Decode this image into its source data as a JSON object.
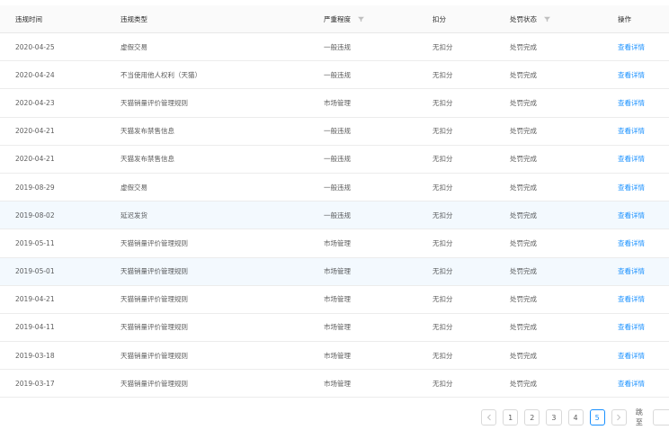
{
  "table": {
    "headers": {
      "date": "违规时间",
      "type": "违规类型",
      "severity": "严重程度",
      "deduction": "扣分",
      "status": "处罚状态",
      "action": "操作"
    },
    "rows": [
      {
        "date": "2020-04-25",
        "type": "虚假交易",
        "severity": "一般违规",
        "deduction": "无扣分",
        "status": "处罚完成",
        "action": "查看详情"
      },
      {
        "date": "2020-04-24",
        "type": "不当使用他人权利（天猫）",
        "severity": "一般违规",
        "deduction": "无扣分",
        "status": "处罚完成",
        "action": "查看详情"
      },
      {
        "date": "2020-04-23",
        "type": "天猫销量评价管理规则",
        "severity": "市场管理",
        "deduction": "无扣分",
        "status": "处罚完成",
        "action": "查看详情"
      },
      {
        "date": "2020-04-21",
        "type": "天猫发布禁售信息",
        "severity": "一般违规",
        "deduction": "无扣分",
        "status": "处罚完成",
        "action": "查看详情"
      },
      {
        "date": "2020-04-21",
        "type": "天猫发布禁售信息",
        "severity": "一般违规",
        "deduction": "无扣分",
        "status": "处罚完成",
        "action": "查看详情"
      },
      {
        "date": "2019-08-29",
        "type": "虚假交易",
        "severity": "一般违规",
        "deduction": "无扣分",
        "status": "处罚完成",
        "action": "查看详情"
      },
      {
        "date": "2019-08-02",
        "type": "延迟发货",
        "severity": "一般违规",
        "deduction": "无扣分",
        "status": "处罚完成",
        "action": "查看详情"
      },
      {
        "date": "2019-05-11",
        "type": "天猫销量评价管理规则",
        "severity": "市场管理",
        "deduction": "无扣分",
        "status": "处罚完成",
        "action": "查看详情"
      },
      {
        "date": "2019-05-01",
        "type": "天猫销量评价管理规则",
        "severity": "市场管理",
        "deduction": "无扣分",
        "status": "处罚完成",
        "action": "查看详情"
      },
      {
        "date": "2019-04-21",
        "type": "天猫销量评价管理规则",
        "severity": "市场管理",
        "deduction": "无扣分",
        "status": "处罚完成",
        "action": "查看详情"
      },
      {
        "date": "2019-04-11",
        "type": "天猫销量评价管理规则",
        "severity": "市场管理",
        "deduction": "无扣分",
        "status": "处罚完成",
        "action": "查看详情"
      },
      {
        "date": "2019-03-18",
        "type": "天猫销量评价管理规则",
        "severity": "市场管理",
        "deduction": "无扣分",
        "status": "处罚完成",
        "action": "查看详情"
      },
      {
        "date": "2019-03-17",
        "type": "天猫销量评价管理规则",
        "severity": "市场管理",
        "deduction": "无扣分",
        "status": "处罚完成",
        "action": "查看详情"
      }
    ]
  },
  "pagination": {
    "prev_icon": "chevron-left-icon",
    "next_icon": "chevron-right-icon",
    "pages": [
      "1",
      "2",
      "3",
      "4",
      "5"
    ],
    "current_page": "5",
    "jump_label": "跳至"
  },
  "colors": {
    "link": "#1890ff",
    "header_bg": "#fafafa",
    "highlight_bg": "#f3f9fe"
  }
}
